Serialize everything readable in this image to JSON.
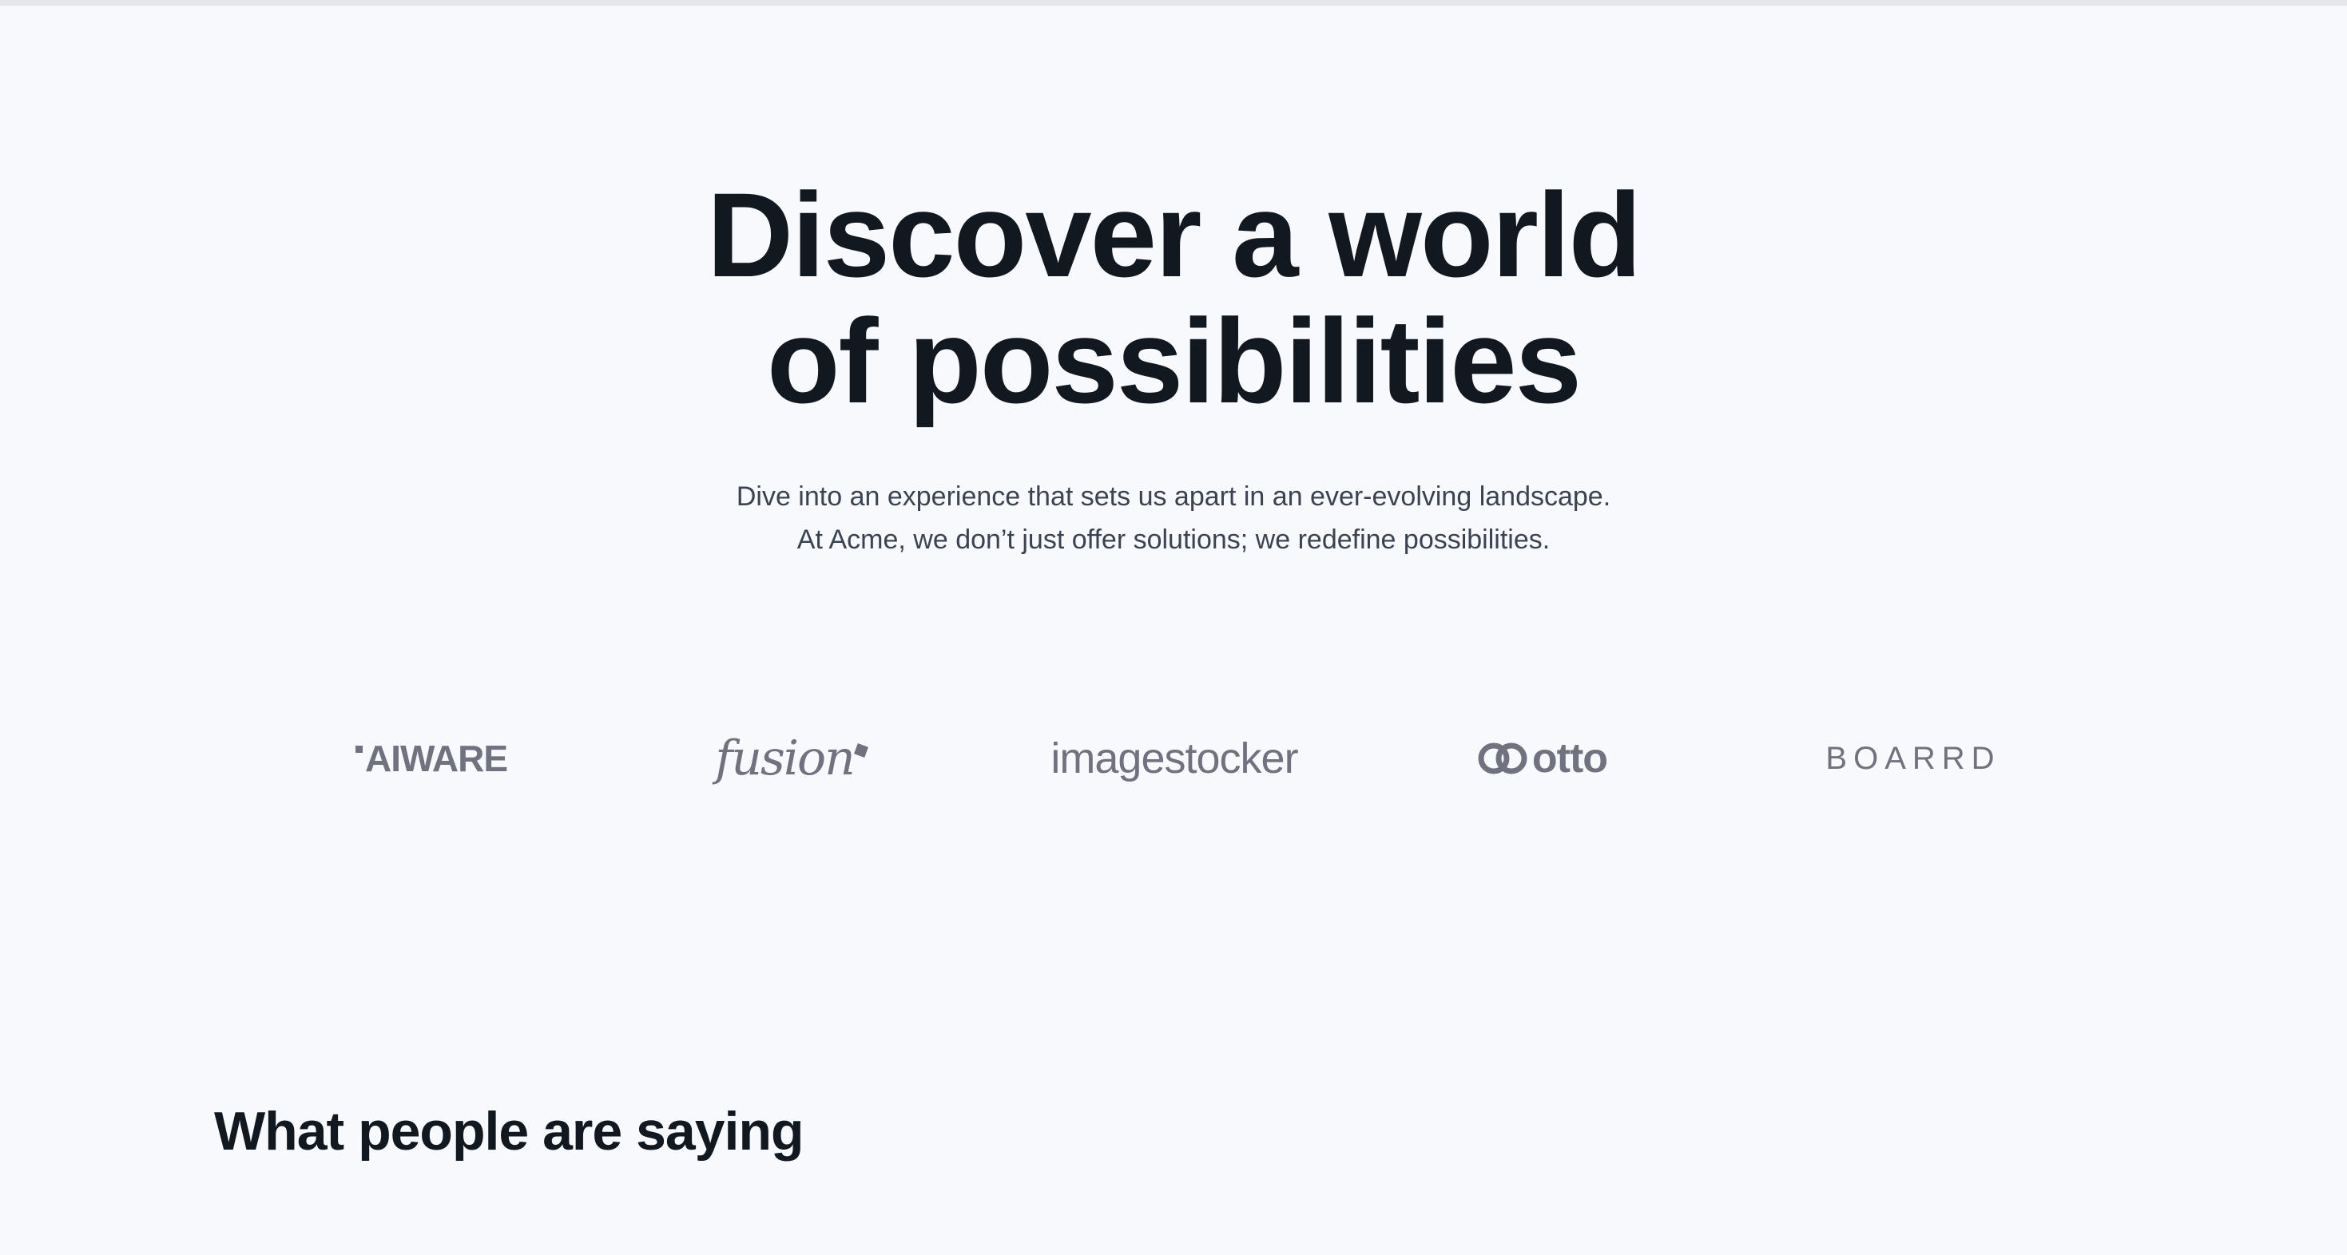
{
  "hero": {
    "title_line1": "Discover a world",
    "title_line2": "of possibilities",
    "subtitle_line1": "Dive into an experience that sets us apart in an ever-evolving landscape.",
    "subtitle_line2": "At Acme, we don’t just offer solutions; we redefine possibilities."
  },
  "logos": {
    "aiware": {
      "name": "AIWARE",
      "icon": "aiware-logo"
    },
    "fusion": {
      "name": "fusion",
      "icon": "fusion-logo"
    },
    "imagestocker": {
      "name": "imagestocker",
      "icon": "imagestocker-logo"
    },
    "otto": {
      "name": "otto",
      "icon": "otto-logo"
    },
    "boarrd": {
      "name": "BOARRD",
      "icon": "boarrd-logo"
    }
  },
  "testimonials": {
    "heading": "What people are saying"
  },
  "colors": {
    "background": "#f8f9fc",
    "heading": "#121820",
    "body_text": "#3b4351",
    "logo_gray": "#70727f"
  }
}
